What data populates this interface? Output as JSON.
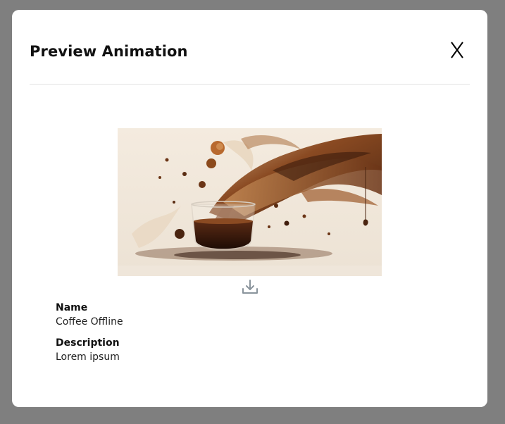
{
  "modal": {
    "title": "Preview Animation",
    "close_label": "X"
  },
  "preview": {
    "image": "coffee-splash-image",
    "download_icon": "download-icon"
  },
  "details": {
    "name_label": "Name",
    "name_value": "Coffee Offline",
    "description_label": "Description",
    "description_value": "Lorem ipsum"
  },
  "colors": {
    "backdrop": "#7f7f7f",
    "modal_bg": "#ffffff",
    "divider": "#e2e2e2",
    "icon": "#8a949c"
  }
}
